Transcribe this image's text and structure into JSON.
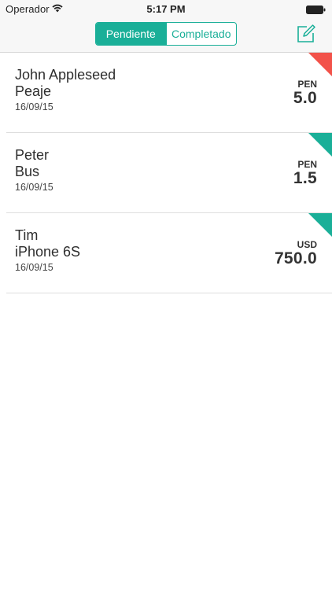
{
  "status_bar": {
    "carrier": "Operador",
    "time": "5:17 PM"
  },
  "nav": {
    "segments": [
      {
        "label": "Pendiente",
        "active": true
      },
      {
        "label": "Completado",
        "active": false
      }
    ],
    "compose_icon": "compose-icon"
  },
  "colors": {
    "accent": "#1aaf98",
    "pending_flag": "#f2524a",
    "ok_flag": "#1aaf98"
  },
  "transactions": [
    {
      "name": "John Appleseed",
      "item": "Peaje",
      "date": "16/09/15",
      "currency": "PEN",
      "amount": "5.0",
      "flag": "red"
    },
    {
      "name": "Peter",
      "item": "Bus",
      "date": "16/09/15",
      "currency": "PEN",
      "amount": "1.5",
      "flag": "green"
    },
    {
      "name": "Tim",
      "item": "iPhone 6S",
      "date": "16/09/15",
      "currency": "USD",
      "amount": "750.0",
      "flag": "green"
    }
  ]
}
